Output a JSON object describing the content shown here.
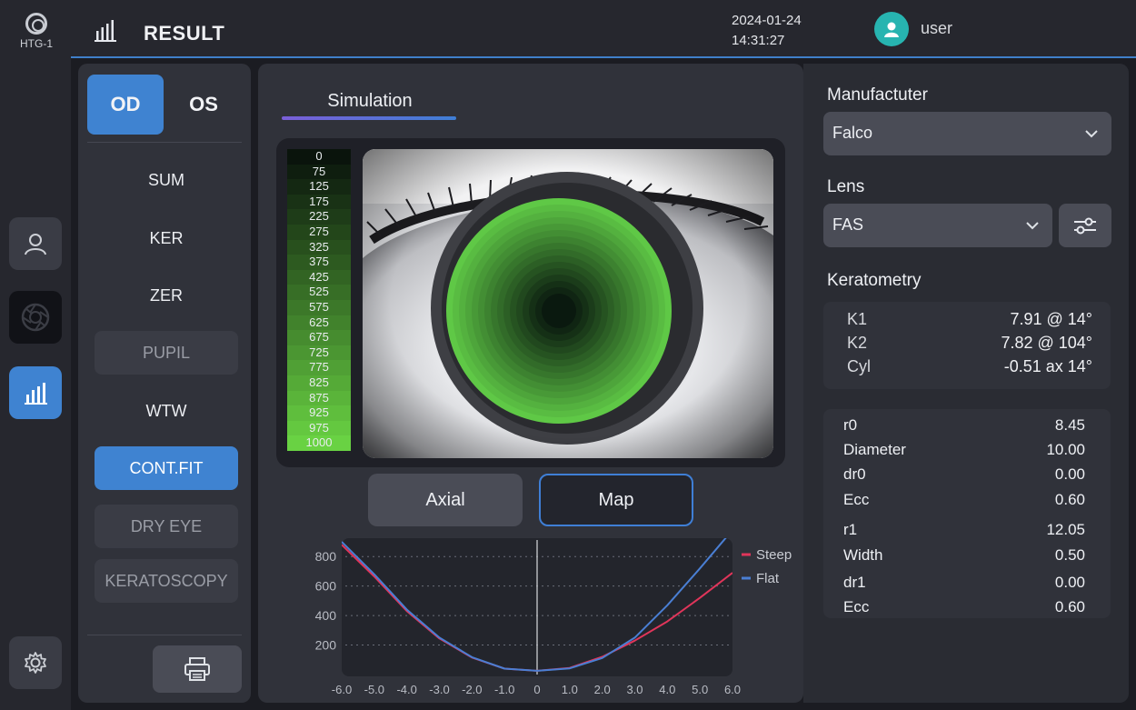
{
  "brand": {
    "label": "HTG-1"
  },
  "header": {
    "title": "RESULT",
    "date": "2024-01-24",
    "time": "14:31:27",
    "user": "user"
  },
  "menu": {
    "eye_toggle": {
      "od": "OD",
      "os": "OS",
      "selected": "OD"
    },
    "items": [
      {
        "label": "SUM",
        "state": "normal"
      },
      {
        "label": "KER",
        "state": "normal"
      },
      {
        "label": "ZER",
        "state": "normal"
      },
      {
        "label": "PUPIL",
        "state": "disabled"
      },
      {
        "label": "WTW",
        "state": "normal"
      },
      {
        "label": "CONT.FIT",
        "state": "active"
      },
      {
        "label": "DRY EYE",
        "state": "disabled"
      },
      {
        "label": "KERATOSCOPY",
        "state": "disabled"
      }
    ]
  },
  "center": {
    "tab_label": "Simulation",
    "scale_values": [
      "0",
      "75",
      "125",
      "175",
      "225",
      "275",
      "325",
      "375",
      "425",
      "525",
      "575",
      "625",
      "675",
      "725",
      "775",
      "825",
      "875",
      "925",
      "975",
      "1000"
    ],
    "buttons": {
      "axial": "Axial",
      "map": "Map",
      "selected": "Map"
    }
  },
  "right": {
    "manufacturer_label": "Manufactuter",
    "manufacturer_value": "Falco",
    "lens_label": "Lens",
    "lens_value": "FAS",
    "keratometry_label": "Keratometry",
    "keratometry": [
      {
        "label": "K1",
        "value": "7.91 @ 14°"
      },
      {
        "label": "K2",
        "value": "7.82 @ 104°"
      },
      {
        "label": "Cyl",
        "value": "-0.51 ax 14°"
      }
    ],
    "params": [
      {
        "label": "r0",
        "value": "8.45"
      },
      {
        "label": "Diameter",
        "value": "10.00"
      },
      {
        "label": "dr0",
        "value": "0.00"
      },
      {
        "label": "Ecc",
        "value": "0.60"
      },
      {
        "label": "r1",
        "value": "12.05"
      },
      {
        "label": "Width",
        "value": "0.50"
      },
      {
        "label": "dr1",
        "value": "0.00"
      },
      {
        "label": "Ecc",
        "value": "0.60"
      }
    ]
  },
  "chart_data": {
    "type": "line",
    "title": "",
    "xlabel": "",
    "ylabel": "",
    "x_ticks": [
      "-6.0",
      "-5.0",
      "-4.0",
      "-3.0",
      "-2.0",
      "-1.0",
      "0",
      "1.0",
      "2.0",
      "3.0",
      "4.0",
      "5.0",
      "6.0"
    ],
    "y_ticks": [
      "800",
      "600",
      "400",
      "200"
    ],
    "xlim": [
      -6.0,
      6.0
    ],
    "ylim": [
      0,
      900
    ],
    "grid": true,
    "legend_position": "right",
    "x": [
      -6.0,
      -5.0,
      -4.0,
      -3.0,
      -2.0,
      -1.0,
      0,
      1.0,
      2.0,
      3.0,
      4.0,
      5.0,
      6.0
    ],
    "series": [
      {
        "name": "Steep",
        "color": "#e0355a",
        "values": [
          880,
          665,
          430,
          245,
          115,
          40,
          25,
          45,
          120,
          230,
          360,
          520,
          690
        ]
      },
      {
        "name": "Flat",
        "color": "#4a7fd4",
        "values": [
          900,
          680,
          440,
          250,
          118,
          40,
          25,
          42,
          112,
          250,
          470,
          720,
          980
        ]
      }
    ]
  }
}
